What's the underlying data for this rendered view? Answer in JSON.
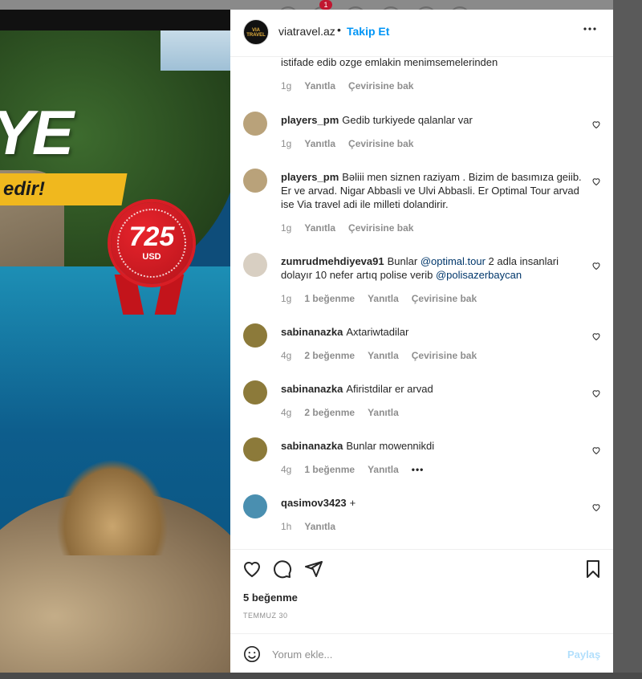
{
  "colors": {
    "accent": "#0095f6",
    "text": "#262626",
    "muted": "#8e8e8e",
    "mention": "#00376b",
    "share_disabled": "#b2dffc"
  },
  "top_nav": {
    "notification_count": "1"
  },
  "post_image": {
    "headline": "YE",
    "band_text": "edir!",
    "price": "725",
    "currency": "USD"
  },
  "header": {
    "username": "viatravel.az",
    "dot": "•",
    "follow_label": "Takip Et",
    "more_icon": "more-horizontal-icon",
    "avatar_text": "VIA TRAVEL"
  },
  "comments": [
    {
      "username": "",
      "text": "istifade edib ozge emlakin menimsemelerinden",
      "time": "1g",
      "likes": "",
      "reply": "Yanıtla",
      "translate": "Çevirisine bak",
      "avatar_color": ""
    },
    {
      "username": "players_pm",
      "text": "Gedib turkiyede qalanlar var",
      "time": "1g",
      "likes": "",
      "reply": "Yanıtla",
      "translate": "Çevirisine bak",
      "avatar_color": "#b9a27a"
    },
    {
      "username": "players_pm",
      "text": "Bəliii men siznen raziyam . Bizim de basımıza geiib. Er ve arvad. Nigar Abbasli ve Ulvi Abbasli. Er Optimal Tour arvad ise Via travel adi ile milleti dolandirir.",
      "time": "1g",
      "likes": "",
      "reply": "Yanıtla",
      "translate": "Çevirisine bak",
      "avatar_color": "#b9a27a"
    },
    {
      "username": "zumrudmehdiyeva91",
      "text_before": "Bunlar ",
      "mention1": "@optimal.tour",
      "text_middle": " 2 adla insanlari dolayır 10 nefer artıq polise verib ",
      "mention2": "@polisazerbaycan",
      "time": "1g",
      "likes": "1 beğenme",
      "reply": "Yanıtla",
      "translate": "Çevirisine bak",
      "avatar_color": "#d8cfc2"
    },
    {
      "username": "sabinanazka",
      "text": "Axtariwtadilar",
      "time": "4g",
      "likes": "2 beğenme",
      "reply": "Yanıtla",
      "translate": "Çevirisine bak",
      "avatar_color": "#8c7a3a"
    },
    {
      "username": "sabinanazka",
      "text": "Afiristdilar er arvad",
      "time": "4g",
      "likes": "2 beğenme",
      "reply": "Yanıtla",
      "translate": "",
      "avatar_color": "#8c7a3a"
    },
    {
      "username": "sabinanazka",
      "text": "Bunlar mowennikdi",
      "time": "4g",
      "likes": "1 beğenme",
      "reply": "Yanıtla",
      "translate": "",
      "more": "•••",
      "avatar_color": "#8c7a3a"
    },
    {
      "username": "qasimov3423",
      "text": "+",
      "time": "1h",
      "likes": "",
      "reply": "Yanıtla",
      "translate": "",
      "avatar_color": "#4a8fb0"
    }
  ],
  "actions": {
    "likes": "5 beğenme",
    "date": "TEMMUZ 30",
    "comment_placeholder": "Yorum ekle...",
    "share_label": "Paylaş"
  }
}
